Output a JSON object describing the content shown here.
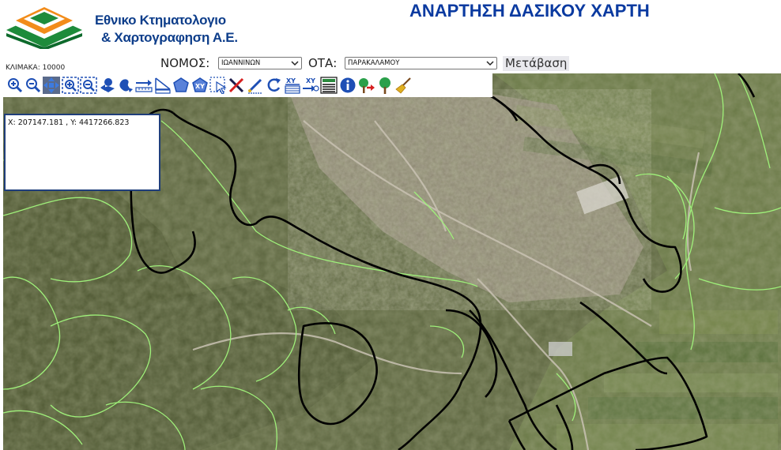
{
  "header": {
    "logo_line1": "Εθνικο Κτηματολογιο",
    "logo_line2": "& Χαρτογραφηση Α.Ε.",
    "title": "ΑΝΑΡΤΗΣΗ ΔΑΣΙΚΟΥ ΧΑΡΤΗ"
  },
  "controls": {
    "scale_label": "ΚΛΙΜΑΚΑ: 10000",
    "nomos_label": "ΝΟΜΟΣ:",
    "nomos_value": "ΙΩΑΝΝΙΝΩΝ",
    "ota_label": "ΟΤΑ:",
    "ota_value": "ΠΑΡΑΚΑΛΑΜΟΥ",
    "go_label": "Μετάβαση"
  },
  "toolbar": {
    "tools": [
      "zoom-in-icon",
      "zoom-out-icon",
      "pan-icon",
      "zoom-box-in-icon",
      "zoom-box-out-icon",
      "previous-extent-icon",
      "full-extent-icon",
      "measure-distance-icon",
      "measure-area-icon",
      "polygon-icon",
      "xy-polygon-icon",
      "select-icon",
      "clear-icon",
      "edit-icon",
      "refresh-icon",
      "xy-table-icon",
      "xy-goto-icon",
      "legend-icon",
      "info-icon",
      "forest-arrow-icon",
      "tree-icon",
      "broom-icon"
    ]
  },
  "coords": {
    "text": "X: 207147.181 , Y: 4417266.823"
  },
  "colors": {
    "title": "#0a3aa0",
    "logo_text": "#0d3d8a",
    "logo_green": "#1e8b3b",
    "logo_orange": "#f28c1a",
    "forest_boundary": "#9ff07a",
    "parcel_boundary": "#000000",
    "toolbar_icon": "#1e4fb5"
  }
}
